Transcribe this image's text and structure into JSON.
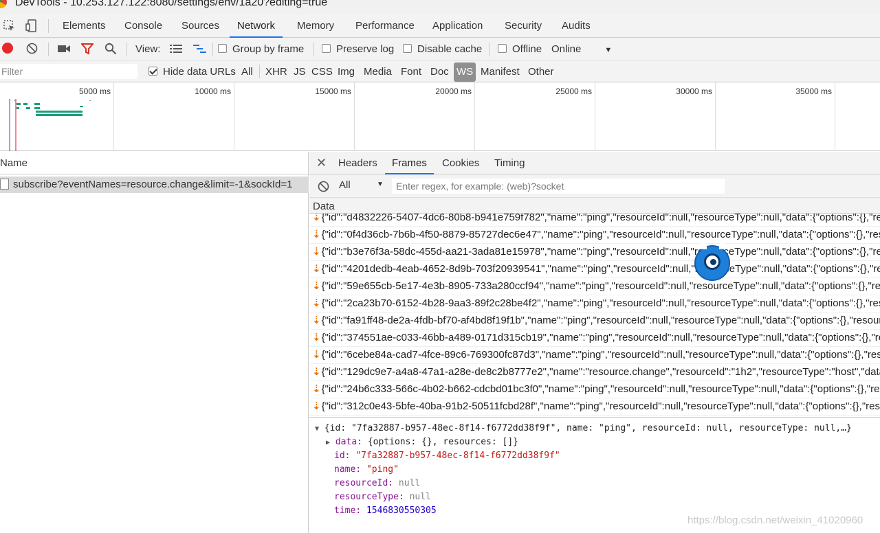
{
  "window": {
    "title": "DevTools - 10.253.127.122:8080/settings/env/1a20?editing=true"
  },
  "panel_tabs": [
    "Elements",
    "Console",
    "Sources",
    "Network",
    "Memory",
    "Performance",
    "Application",
    "Security",
    "Audits"
  ],
  "active_panel": "Network",
  "toolbar": {
    "view_label": "View:",
    "group_by_frame": "Group by frame",
    "preserve_log": "Preserve log",
    "disable_cache": "Disable cache",
    "offline": "Offline",
    "throttle": "Online"
  },
  "filterbar": {
    "placeholder": "Filter",
    "hide_data_urls": "Hide data URLs",
    "types": [
      "All",
      "XHR",
      "JS",
      "CSS",
      "Img",
      "Media",
      "Font",
      "Doc",
      "WS",
      "Manifest",
      "Other"
    ],
    "active_type": "WS"
  },
  "overview": {
    "labels": [
      "5000 ms",
      "10000 ms",
      "15000 ms",
      "20000 ms",
      "25000 ms",
      "30000 ms",
      "35000 ms"
    ]
  },
  "requests": {
    "column_name": "Name",
    "items": [
      "subscribe?eventNames=resource.change&limit=-1&sockId=1"
    ]
  },
  "detail": {
    "tabs": [
      "Headers",
      "Frames",
      "Cookies",
      "Timing"
    ],
    "active_tab": "Frames",
    "frames_filter": {
      "select": "All",
      "placeholder": "Enter regex, for example: (web)?socket"
    },
    "data_header": "Data",
    "frames": [
      "{\"id\":\"d4832226-5407-4dc6-80b8-b941e759f782\",\"name\":\"ping\",\"resourceId\":null,\"resourceType\":null,\"data\":{\"options\":{},\"res",
      "{\"id\":\"0f4d36cb-7b6b-4f50-8879-85727dec6e47\",\"name\":\"ping\",\"resourceId\":null,\"resourceType\":null,\"data\":{\"options\":{},\"reso",
      "{\"id\":\"b3e76f3a-58dc-455d-aa21-3ada81e15978\",\"name\":\"ping\",\"resourceId\":null,\"resourceType\":null,\"data\":{\"options\":{},\"res",
      "{\"id\":\"4201dedb-4eab-4652-8d9b-703f20939541\",\"name\":\"ping\",\"resourceId\":null,\"resourceType\":null,\"data\":{\"options\":{},\"res",
      "{\"id\":\"59e655cb-5e17-4e3b-8905-733a280ccf94\",\"name\":\"ping\",\"resourceId\":null,\"resourceType\":null,\"data\":{\"options\":{},\"res",
      "{\"id\":\"2ca23b70-6152-4b28-9aa3-89f2c28be4f2\",\"name\":\"ping\",\"resourceId\":null,\"resourceType\":null,\"data\":{\"options\":{},\"reso",
      "{\"id\":\"fa91ff48-de2a-4fdb-bf70-af4bd8f19f1b\",\"name\":\"ping\",\"resourceId\":null,\"resourceType\":null,\"data\":{\"options\":{},\"resour",
      "{\"id\":\"374551ae-c033-46bb-a489-0171d315cb19\",\"name\":\"ping\",\"resourceId\":null,\"resourceType\":null,\"data\":{\"options\":{},\"res",
      "{\"id\":\"6cebe84a-cad7-4fce-89c6-769300fc87d3\",\"name\":\"ping\",\"resourceId\":null,\"resourceType\":null,\"data\":{\"options\":{},\"reso",
      "{\"id\":\"129dc9e7-a4a8-47a1-a28e-de8c2b8777e2\",\"name\":\"resource.change\",\"resourceId\":\"1h2\",\"resourceType\":\"host\",\"data\":",
      "{\"id\":\"24b6c333-566c-4b02-b662-cdcbd01bc3f0\",\"name\":\"ping\",\"resourceId\":null,\"resourceType\":null,\"data\":{\"options\":{},\"res",
      "{\"id\":\"312c0e43-5bfe-40ba-91b2-50511fcbd28f\",\"name\":\"ping\",\"resourceId\":null,\"resourceType\":null,\"data\":{\"options\":{},\"reso"
    ],
    "object": {
      "summary": "{id: \"7fa32887-b957-48ec-8f14-f6772dd38f9f\", name: \"ping\", resourceId: null, resourceType: null,…}",
      "data_key": "data:",
      "data_value": "{options: {}, resources: []}",
      "id_key": "id:",
      "id_value": "\"7fa32887-b957-48ec-8f14-f6772dd38f9f\"",
      "name_key": "name:",
      "name_value": "\"ping\"",
      "resourceId_key": "resourceId:",
      "resourceId_value": "null",
      "resourceType_key": "resourceType:",
      "resourceType_value": "null",
      "time_key": "time:",
      "time_value": "1546830550305"
    }
  },
  "watermark": "https://blog.csdn.net/weixin_41020960",
  "colors": {
    "accent": "#1a73e8",
    "record": "#e8262b",
    "arrow": "#e8710a"
  }
}
